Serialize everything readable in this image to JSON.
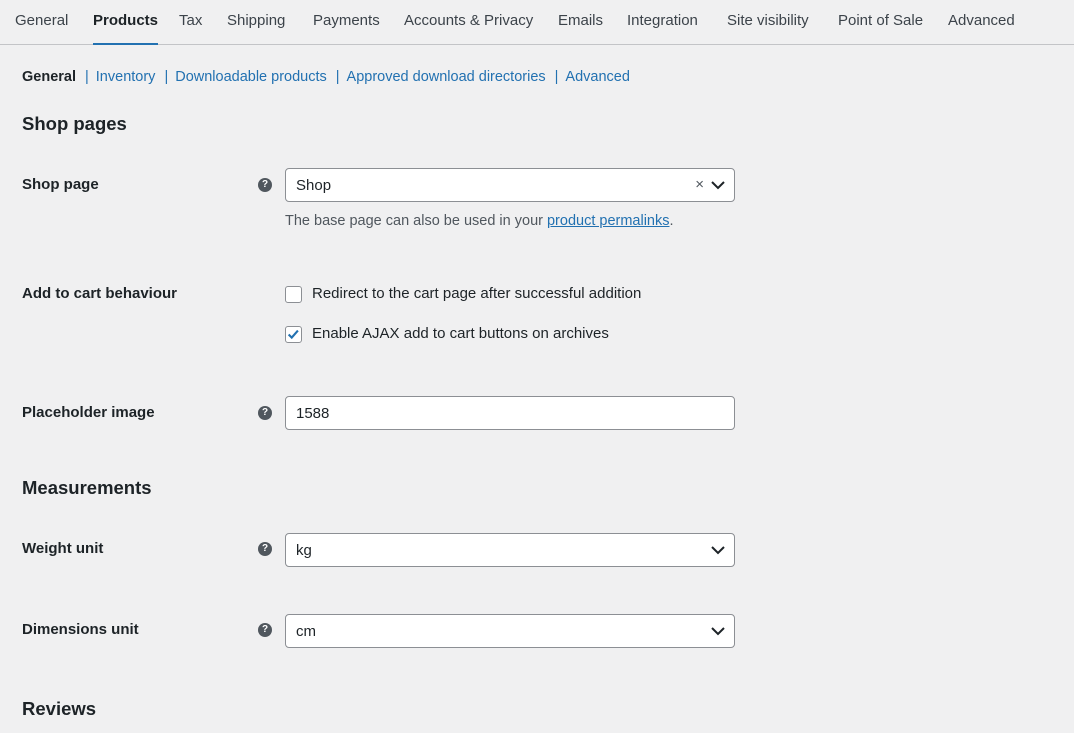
{
  "tabs": [
    {
      "label": "General"
    },
    {
      "label": "Products"
    },
    {
      "label": "Tax"
    },
    {
      "label": "Shipping"
    },
    {
      "label": "Payments"
    },
    {
      "label": "Accounts & Privacy"
    },
    {
      "label": "Emails"
    },
    {
      "label": "Integration"
    },
    {
      "label": "Site visibility"
    },
    {
      "label": "Point of Sale"
    },
    {
      "label": "Advanced"
    }
  ],
  "active_tab": "Products",
  "subnav": {
    "current": "General",
    "links": [
      "Inventory",
      "Downloadable products",
      "Approved download directories",
      "Advanced"
    ],
    "separator": "|"
  },
  "sections": {
    "shop_pages": "Shop pages",
    "measurements": "Measurements",
    "reviews": "Reviews"
  },
  "shop_page": {
    "label": "Shop page",
    "value": "Shop",
    "clear": "×",
    "desc_prefix": "The base page can also be used in your ",
    "desc_link": "product permalinks",
    "desc_suffix": "."
  },
  "add_to_cart": {
    "label": "Add to cart behaviour",
    "redirect_label": "Redirect to the cart page after successful addition",
    "redirect_checked": false,
    "ajax_label": "Enable AJAX add to cart buttons on archives",
    "ajax_checked": true
  },
  "placeholder_image": {
    "label": "Placeholder image",
    "value": "1588"
  },
  "weight_unit": {
    "label": "Weight unit",
    "value": "kg"
  },
  "dimensions_unit": {
    "label": "Dimensions unit",
    "value": "cm"
  },
  "help_glyph": "?",
  "colors": {
    "accent": "#2271b1",
    "background": "#f0f0f1",
    "border": "#8c8f94"
  }
}
